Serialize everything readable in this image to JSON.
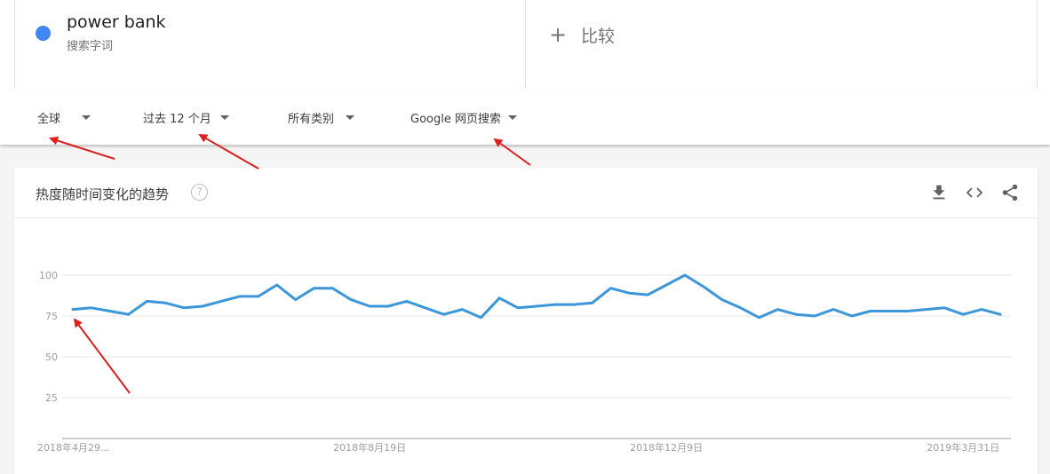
{
  "term": {
    "name": "power bank",
    "sub": "搜索字词",
    "dot_color": "#4285f4"
  },
  "compare": {
    "plus": "+",
    "label": "比较"
  },
  "filters": [
    {
      "label": "全球"
    },
    {
      "label": "过去 12 个月"
    },
    {
      "label": "所有类别"
    },
    {
      "label": "Google 网页搜索"
    }
  ],
  "card": {
    "title": "热度随时间变化的趋势",
    "help": "?",
    "icons": [
      "download-icon",
      "embed-code-icon",
      "share-icon"
    ]
  },
  "chart_data": {
    "type": "line",
    "title": "热度随时间变化的趋势",
    "xlabel": "",
    "ylabel": "",
    "ylim": [
      0,
      100
    ],
    "yticks": [
      25,
      50,
      75,
      100
    ],
    "grid": true,
    "line_color": "#3b97d9",
    "x_tick_labels": [
      {
        "index": 0,
        "label": "2018年4月29..."
      },
      {
        "index": 16,
        "label": "2018年8月19日"
      },
      {
        "index": 32,
        "label": "2018年12月9日"
      },
      {
        "index": 48,
        "label": "2019年3月31日"
      }
    ],
    "series": [
      {
        "values": [
          79,
          80,
          78,
          76,
          84,
          83,
          80,
          81,
          84,
          87,
          87,
          94,
          85,
          92,
          92,
          85,
          81,
          81,
          84,
          80,
          76,
          79,
          74,
          86,
          80,
          81,
          82,
          82,
          83,
          92,
          89,
          88,
          94,
          100,
          93,
          85,
          80,
          74,
          79,
          76,
          75,
          79,
          75,
          78,
          78,
          78,
          79,
          80,
          76,
          79,
          76
        ]
      }
    ]
  }
}
